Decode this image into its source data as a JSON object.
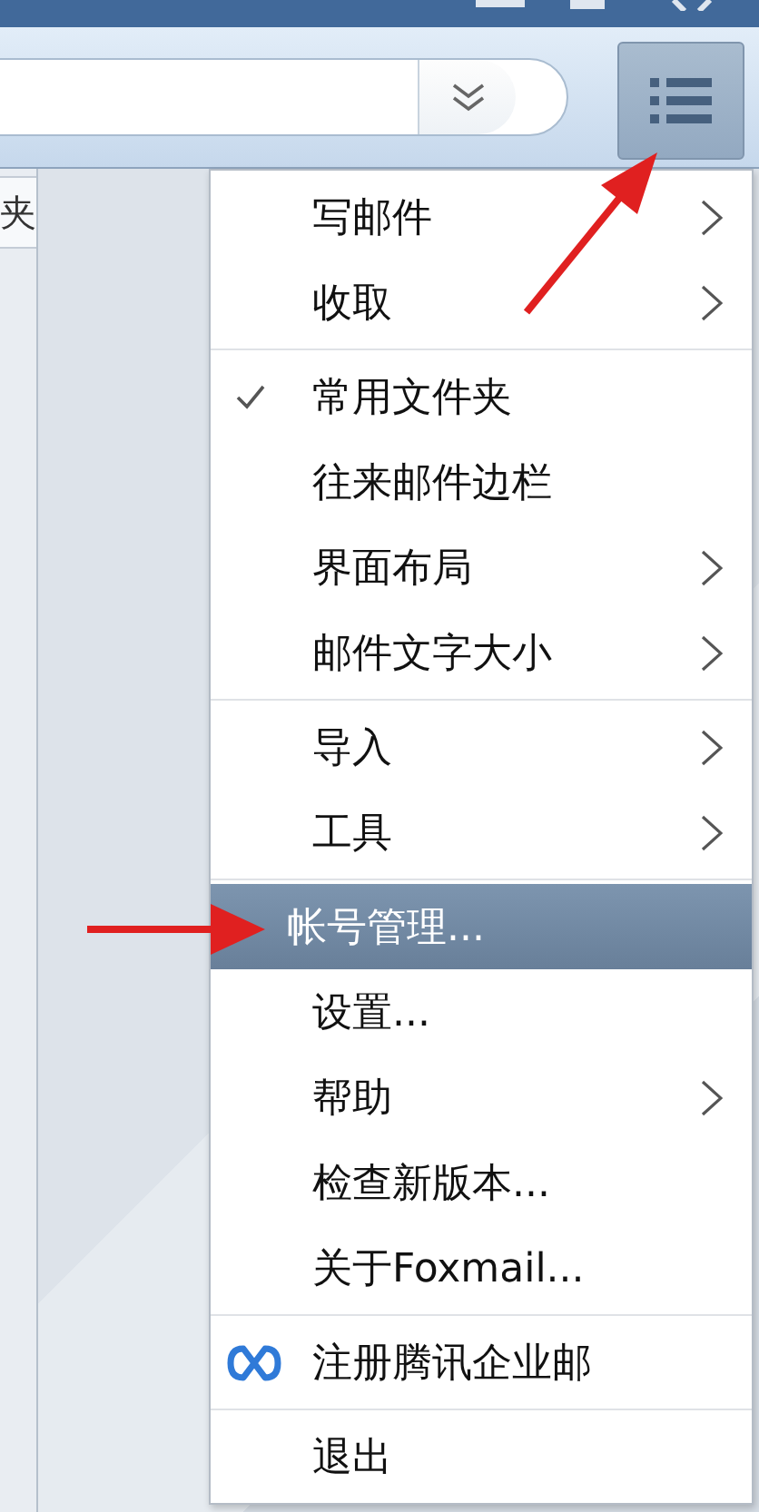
{
  "side_tab": {
    "label": "夹"
  },
  "menu": {
    "sections": [
      {
        "items": [
          {
            "label": "写邮件",
            "kind": "text",
            "submenu": true,
            "checked": false,
            "selected": false
          },
          {
            "label": "收取",
            "kind": "text",
            "submenu": true,
            "checked": false,
            "selected": false
          }
        ]
      },
      {
        "items": [
          {
            "label": "常用文件夹",
            "kind": "text",
            "submenu": false,
            "checked": true,
            "selected": false
          },
          {
            "label": "往来邮件边栏",
            "kind": "text",
            "submenu": false,
            "checked": false,
            "selected": false
          },
          {
            "label": "界面布局",
            "kind": "text",
            "submenu": true,
            "checked": false,
            "selected": false
          },
          {
            "label": "邮件文字大小",
            "kind": "text",
            "submenu": true,
            "checked": false,
            "selected": false
          }
        ]
      },
      {
        "items": [
          {
            "label": "导入",
            "kind": "text",
            "submenu": true,
            "checked": false,
            "selected": false
          },
          {
            "label": "工具",
            "kind": "text",
            "submenu": true,
            "checked": false,
            "selected": false
          }
        ]
      },
      {
        "items": [
          {
            "label": "帐号管理...",
            "kind": "text",
            "submenu": false,
            "checked": false,
            "selected": true
          },
          {
            "label": "设置...",
            "kind": "text",
            "submenu": false,
            "checked": false,
            "selected": false
          },
          {
            "label": "帮助",
            "kind": "text",
            "submenu": true,
            "checked": false,
            "selected": false
          },
          {
            "label": "检查新版本...",
            "kind": "text",
            "submenu": false,
            "checked": false,
            "selected": false
          },
          {
            "label": "关于Foxmail...",
            "kind": "text",
            "submenu": false,
            "checked": false,
            "selected": false
          }
        ]
      },
      {
        "items": [
          {
            "label": "注册腾讯企业邮",
            "kind": "logo",
            "submenu": false,
            "checked": false,
            "selected": false
          }
        ]
      },
      {
        "items": [
          {
            "label": "退出",
            "kind": "text",
            "submenu": false,
            "checked": false,
            "selected": false
          }
        ]
      }
    ]
  }
}
